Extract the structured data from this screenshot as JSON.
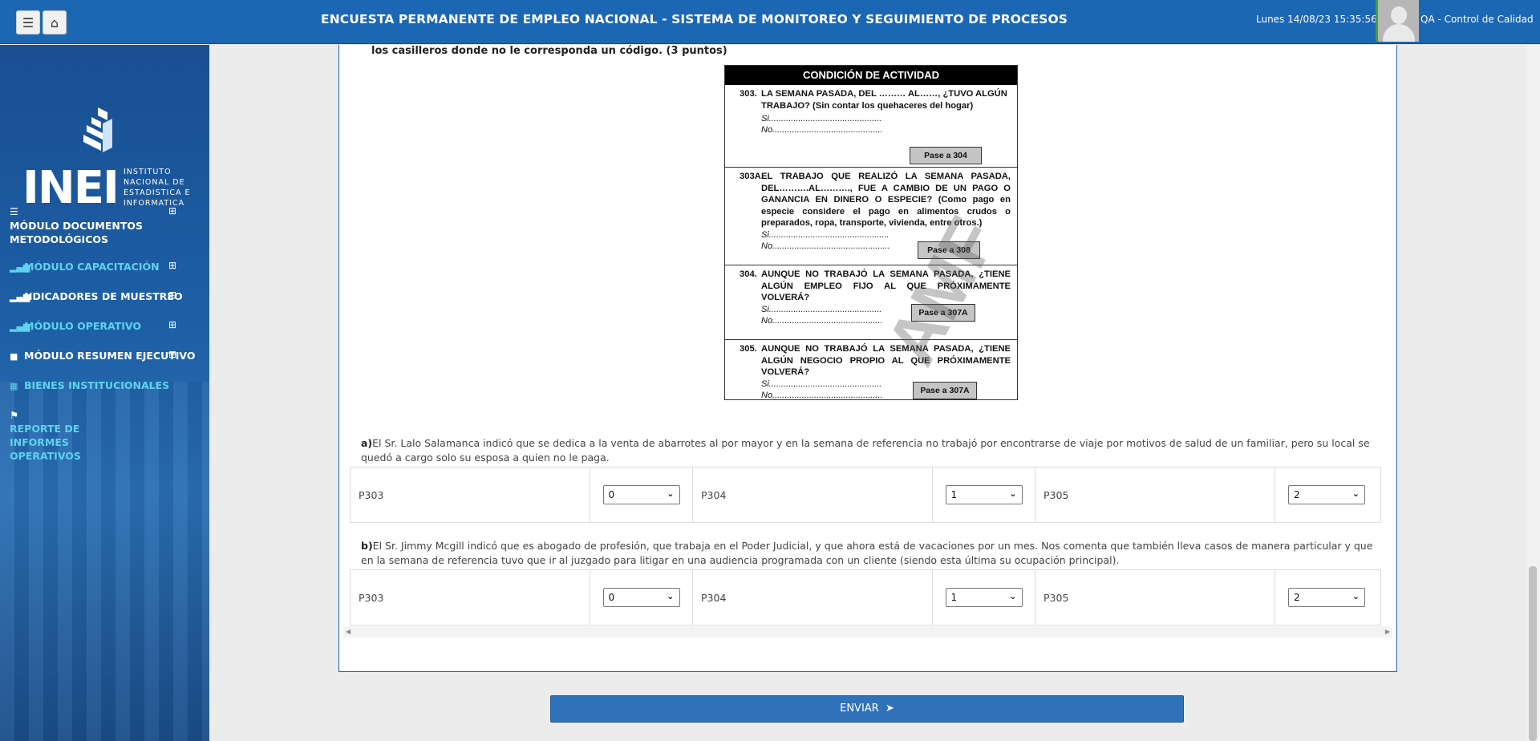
{
  "header": {
    "title": "ENCUESTA PERMANENTE DE EMPLEO NACIONAL - SISTEMA DE MONITOREO Y SEGUIMIENTO DE PROCESOS",
    "datetime": "Lunes 14/08/23 15:35:56",
    "user": "QA - Control de Calidad",
    "menu_icon": "hamburger-icon",
    "home_icon": "home-icon"
  },
  "sidebar": {
    "logo_word": "INEI",
    "logo_sub": [
      "INSTITUTO",
      "NACIONAL DE",
      "ESTADISTICA E",
      "INFORMATICA"
    ],
    "items": [
      {
        "label": "MÓDULO DOCUMENTOS METODOLÓGICOS",
        "icon": "list-icon"
      },
      {
        "label": "MÓDULO CAPACITACIÓN",
        "icon": "bar-chart-icon"
      },
      {
        "label": "NDICADORES DE MUESTREO",
        "icon": "bar-chart-icon"
      },
      {
        "label": "MÓDULO OPERATIVO",
        "icon": "bar-chart-icon"
      },
      {
        "label": "MÓDULO RESUMEN EJECUTIVO",
        "icon": "briefcase-icon"
      },
      {
        "label": "BIENES INSTITUCIONALES",
        "icon": "table-icon"
      },
      {
        "label": "REPORTE DE INFORMES OPERATIVOS",
        "icon": "flag-icon"
      }
    ],
    "plus": "⊞"
  },
  "question": {
    "text": "los casilleros donde no le corresponda un código. (3 puntos)"
  },
  "form_image": {
    "header": "CONDICIÓN DE ACTIVIDAD",
    "q303_num": "303.",
    "q303": "LA SEMANA PASADA, DEL ……… AL……, ¿TUVO ALGÚN TRABAJO? (Sin contar los quehaceres del hogar)",
    "q303_si": "Si..................................................... 1",
    "q303_no": "No................................................... 2",
    "q303_pase": "Pase a 304",
    "q303a_num": "303A.",
    "q303a": "EL TRABAJO QUE REALIZÓ LA SEMANA PASADA, DEL……….AL………., FUE A CAMBIO DE UN PAGO O GANANCIA EN DINERO O ESPECIE? (Como pago en especie considere el pago en alimentos crudos o preparados, ropa, transporte, vivienda, entre otros.)",
    "q303a_si": "Si..................................................... 1",
    "q303a_no": "No................................................... 2",
    "q303a_pase": "Pase a 308",
    "q304_num": "304.",
    "q304": "AUNQUE NO TRABAJÓ LA SEMANA PASADA, ¿TIENE ALGÚN EMPLEO FIJO AL QUE PRÓXIMAMENTE VOLVERÁ?",
    "q304_si": "Si..................................................... 1",
    "q304_no": "No................................................... 2",
    "q304_pase": "Pase a 307A",
    "q305_num": "305.",
    "q305": "AUNQUE NO TRABAJÓ LA SEMANA PASADA, ¿TIENE ALGÚN NEGOCIO PROPIO AL QUE PRÓXIMAMENTE VOLVERÁ?",
    "q305_si": "Si..................................................... 1",
    "q305_no": "No................................................... 2",
    "q305_pase": "Pase a 307A",
    "watermark": "AMF"
  },
  "case_a": {
    "letter": "a)",
    "text": "El Sr. Lalo Salamanca indicó que se dedica a la venta de abarrotes al por mayor y en la semana de referencia no trabajó por encontrarse de viaje por motivos de salud de un familiar, pero su local se quedó a cargo solo su esposa a quien no le paga.",
    "p303_label": "P303",
    "p303_value": "0",
    "p304_label": "P304",
    "p304_value": "1",
    "p305_label": "P305",
    "p305_value": "2"
  },
  "case_b": {
    "letter": "b)",
    "text": "El Sr. Jimmy Mcgill indicó que es abogado de profesión, que trabaja en el Poder Judicial, y que ahora está de vacaciones por un mes. Nos comenta que también lleva casos de manera particular y que en la semana de referencia tuvo que ir al juzgado para litigar en una audiencia programada con un cliente (siendo esta última su ocupación principal).",
    "p303_label": "P303",
    "p303_value": "0",
    "p304_label": "P304",
    "p304_value": "1",
    "p305_label": "P305",
    "p305_value": "2"
  },
  "submit": {
    "label": "ENVIAR",
    "icon": "paper-plane-icon"
  }
}
